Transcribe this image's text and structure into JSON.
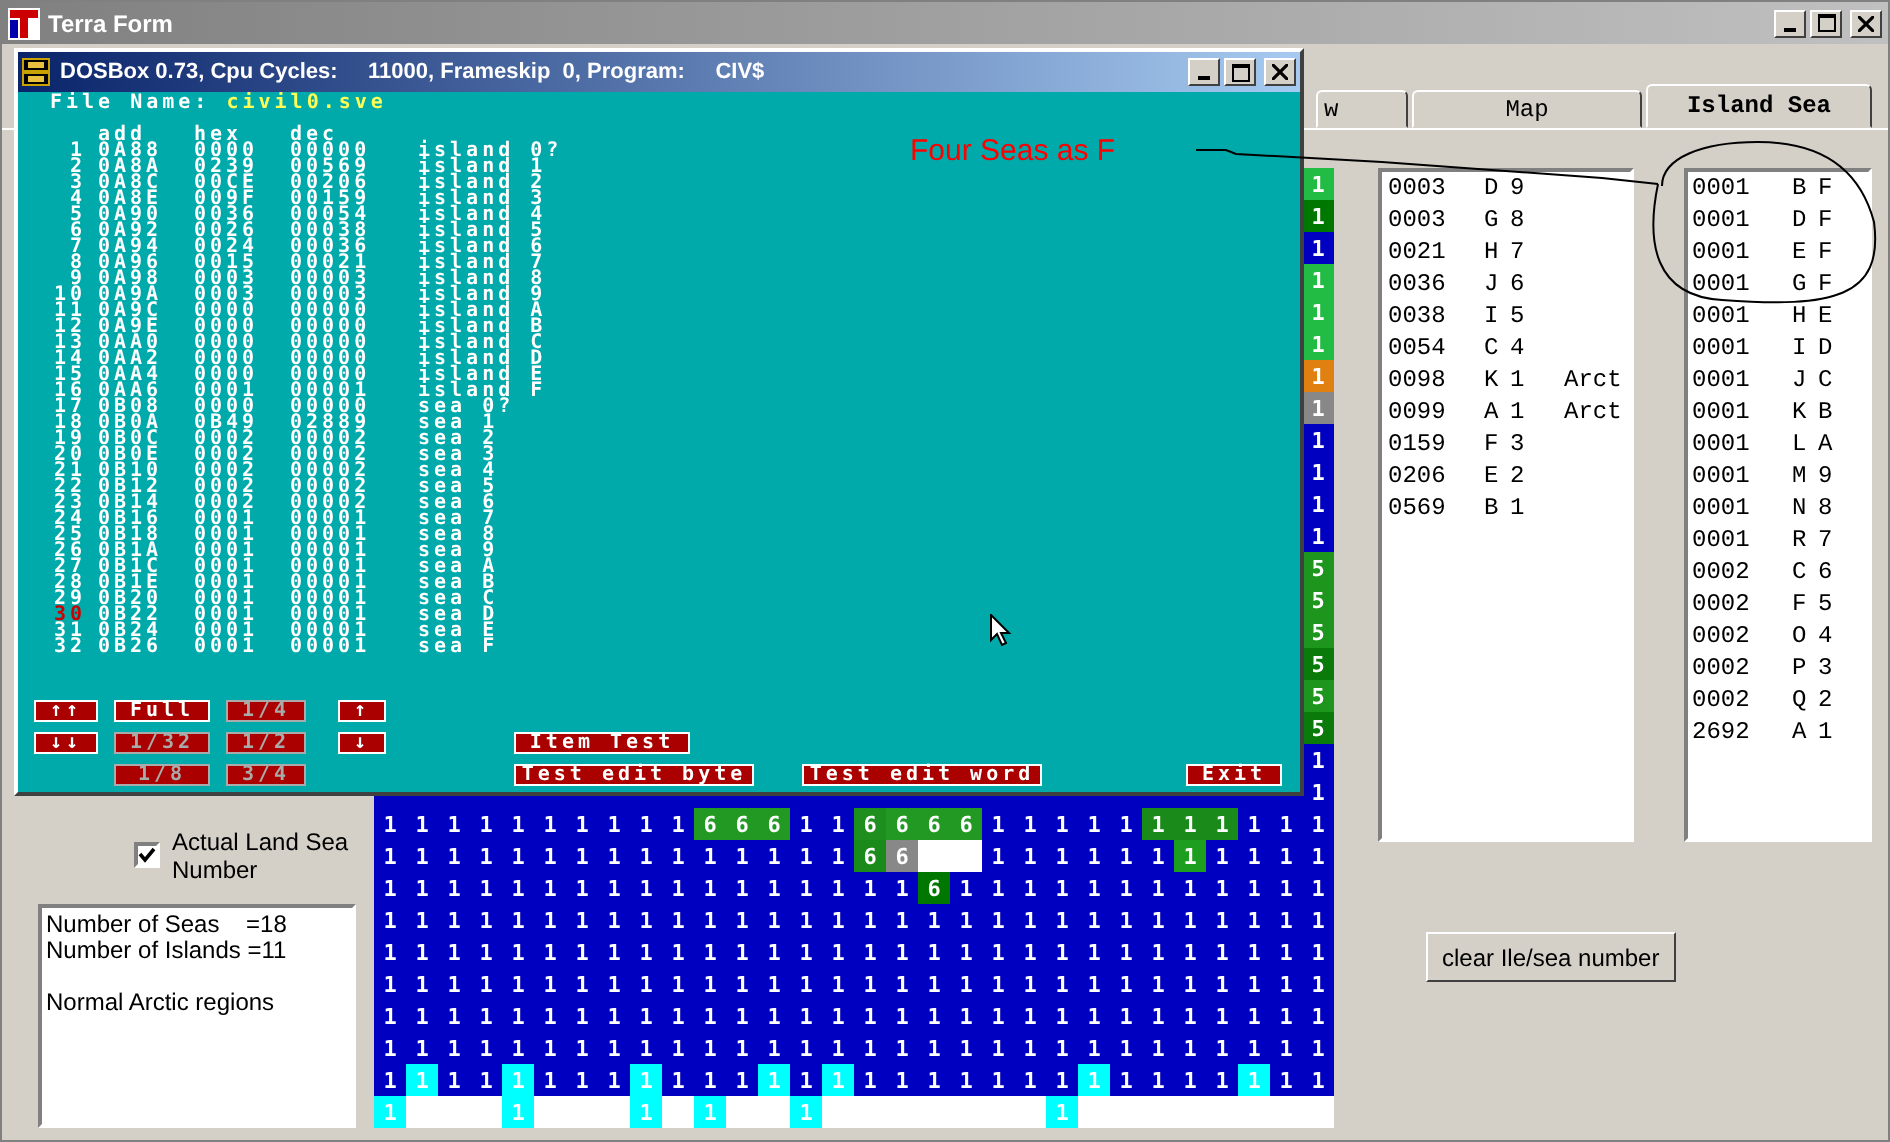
{
  "window": {
    "title": "Terra Form"
  },
  "tabs": [
    {
      "label": "w",
      "selected": false
    },
    {
      "label": "Map",
      "selected": false
    },
    {
      "label": "Island Sea",
      "selected": true
    }
  ],
  "left_panel": {
    "checkbox": {
      "label": "Actual Land Sea Number",
      "checked": true
    },
    "info_paragraphs": [
      [
        "Number of Seas    =18",
        "Number of Islands =11"
      ],
      [
        "Normal Arctic regions"
      ]
    ]
  },
  "map": {
    "edge_cells": [
      {
        "value": "1",
        "color": "#22bb44"
      },
      {
        "value": "1",
        "color": "#007700"
      },
      {
        "value": "1",
        "color": "#0000c0"
      },
      {
        "value": "1",
        "color": "#22bb44"
      },
      {
        "value": "1",
        "color": "#22bb44"
      },
      {
        "value": "1",
        "color": "#22bb44"
      },
      {
        "value": "1",
        "color": "#e08010"
      },
      {
        "value": "1",
        "color": "#888888"
      },
      {
        "value": "1",
        "color": "#0000c0"
      },
      {
        "value": "1",
        "color": "#0000c0"
      },
      {
        "value": "1",
        "color": "#0000c0"
      },
      {
        "value": "1",
        "color": "#0000c0"
      },
      {
        "value": "5",
        "color": "#1e961e"
      },
      {
        "value": "5",
        "color": "#1e961e"
      },
      {
        "value": "5",
        "color": "#1e961e"
      },
      {
        "value": "5",
        "color": "#0a7a0a"
      },
      {
        "value": "5",
        "color": "#1e961e"
      },
      {
        "value": "5",
        "color": "#0a7a0a"
      },
      {
        "value": "1",
        "color": "#0000c0"
      },
      {
        "value": "1",
        "color": "#0000c0"
      }
    ],
    "rows": [
      {
        "cells": [
          {
            "value": "1",
            "color": "#0000c0"
          },
          {
            "value": "1",
            "color": "#0000c0"
          },
          {
            "value": "1",
            "color": "#0000c0"
          },
          {
            "value": "1",
            "color": "#0000c0"
          },
          {
            "value": "1",
            "color": "#0000c0"
          },
          {
            "value": "1",
            "color": "#0000c0"
          },
          {
            "value": "1",
            "color": "#0000c0"
          },
          {
            "value": "1",
            "color": "#0000c0"
          },
          {
            "value": "1",
            "color": "#0000c0"
          },
          {
            "value": "1",
            "color": "#0000c0"
          },
          {
            "value": "6",
            "color": "#229922"
          },
          {
            "value": "6",
            "color": "#229922"
          },
          {
            "value": "6",
            "color": "#229922"
          },
          {
            "value": "1",
            "color": "#0000c0"
          },
          {
            "value": "1",
            "color": "#0000c0"
          },
          {
            "value": "6",
            "color": "#1e8e1e"
          },
          {
            "value": "6",
            "color": "#229922"
          },
          {
            "value": "6",
            "color": "#229922"
          },
          {
            "value": "6",
            "color": "#229922"
          },
          {
            "value": "1",
            "color": "#0000c0"
          },
          {
            "value": "1",
            "color": "#0000c0"
          },
          {
            "value": "1",
            "color": "#0000c0"
          },
          {
            "value": "1",
            "color": "#0000c0"
          },
          {
            "value": "1",
            "color": "#0000c0"
          },
          {
            "value": "1",
            "color": "#1a8a1a"
          },
          {
            "value": "1",
            "color": "#1a8a1a"
          },
          {
            "value": "1",
            "color": "#1a8a1a"
          },
          {
            "value": "1",
            "color": "#0000c0"
          },
          {
            "value": "1",
            "color": "#0000c0"
          },
          {
            "value": "1",
            "color": "#0000c0"
          }
        ]
      },
      {
        "cells": [
          {
            "value": "1",
            "color": "#0000c0"
          },
          {
            "value": "1",
            "color": "#0000c0"
          },
          {
            "value": "1",
            "color": "#0000c0"
          },
          {
            "value": "1",
            "color": "#0000c0"
          },
          {
            "value": "1",
            "color": "#0000c0"
          },
          {
            "value": "1",
            "color": "#0000c0"
          },
          {
            "value": "1",
            "color": "#0000c0"
          },
          {
            "value": "1",
            "color": "#0000c0"
          },
          {
            "value": "1",
            "color": "#0000c0"
          },
          {
            "value": "1",
            "color": "#0000c0"
          },
          {
            "value": "1",
            "color": "#0000c0"
          },
          {
            "value": "1",
            "color": "#0000c0"
          },
          {
            "value": "1",
            "color": "#0000c0"
          },
          {
            "value": "1",
            "color": "#0000c0"
          },
          {
            "value": "1",
            "color": "#0000c0"
          },
          {
            "value": "6",
            "color": "#1a8a1a"
          },
          {
            "value": "6",
            "color": "#888888"
          },
          {
            "color": "#ffffff"
          },
          {
            "color": "#ffffff"
          },
          {
            "value": "1",
            "color": "#0000c0"
          },
          {
            "value": "1",
            "color": "#0000c0"
          },
          {
            "value": "1",
            "color": "#0000c0"
          },
          {
            "value": "1",
            "color": "#0000c0"
          },
          {
            "value": "1",
            "color": "#0000c0"
          },
          {
            "value": "1",
            "color": "#0000c0"
          },
          {
            "value": "1",
            "color": "#1e9e1e"
          },
          {
            "value": "1",
            "color": "#0000c0"
          },
          {
            "value": "1",
            "color": "#0000c0"
          },
          {
            "value": "1",
            "color": "#0000c0"
          },
          {
            "value": "1",
            "color": "#0000c0"
          }
        ]
      },
      {
        "cells": [
          {
            "value": "1",
            "color": "#0000c0"
          },
          {
            "value": "1",
            "color": "#0000c0"
          },
          {
            "value": "1",
            "color": "#0000c0"
          },
          {
            "value": "1",
            "color": "#0000c0"
          },
          {
            "value": "1",
            "color": "#0000c0"
          },
          {
            "value": "1",
            "color": "#0000c0"
          },
          {
            "value": "1",
            "color": "#0000c0"
          },
          {
            "value": "1",
            "color": "#0000c0"
          },
          {
            "value": "1",
            "color": "#0000c0"
          },
          {
            "value": "1",
            "color": "#0000c0"
          },
          {
            "value": "1",
            "color": "#0000c0"
          },
          {
            "value": "1",
            "color": "#0000c0"
          },
          {
            "value": "1",
            "color": "#0000c0"
          },
          {
            "value": "1",
            "color": "#0000c0"
          },
          {
            "value": "1",
            "color": "#0000c0"
          },
          {
            "value": "1",
            "color": "#0000c0"
          },
          {
            "value": "1",
            "color": "#0000c0"
          },
          {
            "value": "6",
            "color": "#007700"
          },
          {
            "value": "1",
            "color": "#0000c0"
          },
          {
            "value": "1",
            "color": "#0000c0"
          },
          {
            "value": "1",
            "color": "#0000c0"
          },
          {
            "value": "1",
            "color": "#0000c0"
          },
          {
            "value": "1",
            "color": "#0000c0"
          },
          {
            "value": "1",
            "color": "#0000c0"
          },
          {
            "value": "1",
            "color": "#0000c0"
          },
          {
            "value": "1",
            "color": "#0000c0"
          },
          {
            "value": "1",
            "color": "#0000c0"
          },
          {
            "value": "1",
            "color": "#0000c0"
          },
          {
            "value": "1",
            "color": "#0000c0"
          },
          {
            "value": "1",
            "color": "#0000c0"
          }
        ]
      },
      {
        "cells": [
          {
            "value": "1",
            "color": "#0000c0"
          },
          {
            "value": "1",
            "color": "#0000c0"
          },
          {
            "value": "1",
            "color": "#0000c0"
          },
          {
            "value": "1",
            "color": "#0000c0"
          },
          {
            "value": "1",
            "color": "#0000c0"
          },
          {
            "value": "1",
            "color": "#0000c0"
          },
          {
            "value": "1",
            "color": "#0000c0"
          },
          {
            "value": "1",
            "color": "#0000c0"
          },
          {
            "value": "1",
            "color": "#0000c0"
          },
          {
            "value": "1",
            "color": "#0000c0"
          },
          {
            "value": "1",
            "color": "#0000c0"
          },
          {
            "value": "1",
            "color": "#0000c0"
          },
          {
            "value": "1",
            "color": "#0000c0"
          },
          {
            "value": "1",
            "color": "#0000c0"
          },
          {
            "value": "1",
            "color": "#0000c0"
          },
          {
            "value": "1",
            "color": "#0000c0"
          },
          {
            "value": "1",
            "color": "#0000c0"
          },
          {
            "value": "1",
            "color": "#0000c0"
          },
          {
            "value": "1",
            "color": "#0000c0"
          },
          {
            "value": "1",
            "color": "#0000c0"
          },
          {
            "value": "1",
            "color": "#0000c0"
          },
          {
            "value": "1",
            "color": "#0000c0"
          },
          {
            "value": "1",
            "color": "#0000c0"
          },
          {
            "value": "1",
            "color": "#0000c0"
          },
          {
            "value": "1",
            "color": "#0000c0"
          },
          {
            "value": "1",
            "color": "#0000c0"
          },
          {
            "value": "1",
            "color": "#0000c0"
          },
          {
            "value": "1",
            "color": "#0000c0"
          },
          {
            "value": "1",
            "color": "#0000c0"
          },
          {
            "value": "1",
            "color": "#0000c0"
          }
        ]
      },
      {
        "cells": [
          {
            "value": "1",
            "color": "#0000c0"
          },
          {
            "value": "1",
            "color": "#0000c0"
          },
          {
            "value": "1",
            "color": "#0000c0"
          },
          {
            "value": "1",
            "color": "#0000c0"
          },
          {
            "value": "1",
            "color": "#0000c0"
          },
          {
            "value": "1",
            "color": "#0000c0"
          },
          {
            "value": "1",
            "color": "#0000c0"
          },
          {
            "value": "1",
            "color": "#0000c0"
          },
          {
            "value": "1",
            "color": "#0000c0"
          },
          {
            "value": "1",
            "color": "#0000c0"
          },
          {
            "value": "1",
            "color": "#0000c0"
          },
          {
            "value": "1",
            "color": "#0000c0"
          },
          {
            "value": "1",
            "color": "#0000c0"
          },
          {
            "value": "1",
            "color": "#0000c0"
          },
          {
            "value": "1",
            "color": "#0000c0"
          },
          {
            "value": "1",
            "color": "#0000c0"
          },
          {
            "value": "1",
            "color": "#0000c0"
          },
          {
            "value": "1",
            "color": "#0000c0"
          },
          {
            "value": "1",
            "color": "#0000c0"
          },
          {
            "value": "1",
            "color": "#0000c0"
          },
          {
            "value": "1",
            "color": "#0000c0"
          },
          {
            "value": "1",
            "color": "#0000c0"
          },
          {
            "value": "1",
            "color": "#0000c0"
          },
          {
            "value": "1",
            "color": "#0000c0"
          },
          {
            "value": "1",
            "color": "#0000c0"
          },
          {
            "value": "1",
            "color": "#0000c0"
          },
          {
            "value": "1",
            "color": "#0000c0"
          },
          {
            "value": "1",
            "color": "#0000c0"
          },
          {
            "value": "1",
            "color": "#0000c0"
          },
          {
            "value": "1",
            "color": "#0000c0"
          }
        ]
      },
      {
        "cells": [
          {
            "value": "1",
            "color": "#0000c0"
          },
          {
            "value": "1",
            "color": "#0000c0"
          },
          {
            "value": "1",
            "color": "#0000c0"
          },
          {
            "value": "1",
            "color": "#0000c0"
          },
          {
            "value": "1",
            "color": "#0000c0"
          },
          {
            "value": "1",
            "color": "#0000c0"
          },
          {
            "value": "1",
            "color": "#0000c0"
          },
          {
            "value": "1",
            "color": "#0000c0"
          },
          {
            "value": "1",
            "color": "#0000c0"
          },
          {
            "value": "1",
            "color": "#0000c0"
          },
          {
            "value": "1",
            "color": "#0000c0"
          },
          {
            "value": "1",
            "color": "#0000c0"
          },
          {
            "value": "1",
            "color": "#0000c0"
          },
          {
            "value": "1",
            "color": "#0000c0"
          },
          {
            "value": "1",
            "color": "#0000c0"
          },
          {
            "value": "1",
            "color": "#0000c0"
          },
          {
            "value": "1",
            "color": "#0000c0"
          },
          {
            "value": "1",
            "color": "#0000c0"
          },
          {
            "value": "1",
            "color": "#0000c0"
          },
          {
            "value": "1",
            "color": "#0000c0"
          },
          {
            "value": "1",
            "color": "#0000c0"
          },
          {
            "value": "1",
            "color": "#0000c0"
          },
          {
            "value": "1",
            "color": "#0000c0"
          },
          {
            "value": "1",
            "color": "#0000c0"
          },
          {
            "value": "1",
            "color": "#0000c0"
          },
          {
            "value": "1",
            "color": "#0000c0"
          },
          {
            "value": "1",
            "color": "#0000c0"
          },
          {
            "value": "1",
            "color": "#0000c0"
          },
          {
            "value": "1",
            "color": "#0000c0"
          },
          {
            "value": "1",
            "color": "#0000c0"
          }
        ]
      },
      {
        "cells": [
          {
            "value": "1",
            "color": "#0000c0"
          },
          {
            "value": "1",
            "color": "#0000c0"
          },
          {
            "value": "1",
            "color": "#0000c0"
          },
          {
            "value": "1",
            "color": "#0000c0"
          },
          {
            "value": "1",
            "color": "#0000c0"
          },
          {
            "value": "1",
            "color": "#0000c0"
          },
          {
            "value": "1",
            "color": "#0000c0"
          },
          {
            "value": "1",
            "color": "#0000c0"
          },
          {
            "value": "1",
            "color": "#0000c0"
          },
          {
            "value": "1",
            "color": "#0000c0"
          },
          {
            "value": "1",
            "color": "#0000c0"
          },
          {
            "value": "1",
            "color": "#0000c0"
          },
          {
            "value": "1",
            "color": "#0000c0"
          },
          {
            "value": "1",
            "color": "#0000c0"
          },
          {
            "value": "1",
            "color": "#0000c0"
          },
          {
            "value": "1",
            "color": "#0000c0"
          },
          {
            "value": "1",
            "color": "#0000c0"
          },
          {
            "value": "1",
            "color": "#0000c0"
          },
          {
            "value": "1",
            "color": "#0000c0"
          },
          {
            "value": "1",
            "color": "#0000c0"
          },
          {
            "value": "1",
            "color": "#0000c0"
          },
          {
            "value": "1",
            "color": "#0000c0"
          },
          {
            "value": "1",
            "color": "#0000c0"
          },
          {
            "value": "1",
            "color": "#0000c0"
          },
          {
            "value": "1",
            "color": "#0000c0"
          },
          {
            "value": "1",
            "color": "#0000c0"
          },
          {
            "value": "1",
            "color": "#0000c0"
          },
          {
            "value": "1",
            "color": "#0000c0"
          },
          {
            "value": "1",
            "color": "#0000c0"
          },
          {
            "value": "1",
            "color": "#0000c0"
          }
        ]
      },
      {
        "cells": [
          {
            "value": "1",
            "color": "#0000c0"
          },
          {
            "value": "1",
            "color": "#0000c0"
          },
          {
            "value": "1",
            "color": "#0000c0"
          },
          {
            "value": "1",
            "color": "#0000c0"
          },
          {
            "value": "1",
            "color": "#0000c0"
          },
          {
            "value": "1",
            "color": "#0000c0"
          },
          {
            "value": "1",
            "color": "#0000c0"
          },
          {
            "value": "1",
            "color": "#0000c0"
          },
          {
            "value": "1",
            "color": "#0000c0"
          },
          {
            "value": "1",
            "color": "#0000c0"
          },
          {
            "value": "1",
            "color": "#0000c0"
          },
          {
            "value": "1",
            "color": "#0000c0"
          },
          {
            "value": "1",
            "color": "#0000c0"
          },
          {
            "value": "1",
            "color": "#0000c0"
          },
          {
            "value": "1",
            "color": "#0000c0"
          },
          {
            "value": "1",
            "color": "#0000c0"
          },
          {
            "value": "1",
            "color": "#0000c0"
          },
          {
            "value": "1",
            "color": "#0000c0"
          },
          {
            "value": "1",
            "color": "#0000c0"
          },
          {
            "value": "1",
            "color": "#0000c0"
          },
          {
            "value": "1",
            "color": "#0000c0"
          },
          {
            "value": "1",
            "color": "#0000c0"
          },
          {
            "value": "1",
            "color": "#0000c0"
          },
          {
            "value": "1",
            "color": "#0000c0"
          },
          {
            "value": "1",
            "color": "#0000c0"
          },
          {
            "value": "1",
            "color": "#0000c0"
          },
          {
            "value": "1",
            "color": "#0000c0"
          },
          {
            "value": "1",
            "color": "#0000c0"
          },
          {
            "value": "1",
            "color": "#0000c0"
          },
          {
            "value": "1",
            "color": "#0000c0"
          }
        ]
      },
      {
        "cells": [
          {
            "value": "1",
            "color": "#0000c0"
          },
          {
            "value": "1",
            "color": "#00ffff"
          },
          {
            "value": "1",
            "color": "#0000c0"
          },
          {
            "value": "1",
            "color": "#0000c0"
          },
          {
            "value": "1",
            "color": "#00ffff"
          },
          {
            "value": "1",
            "color": "#0000c0"
          },
          {
            "value": "1",
            "color": "#0000c0"
          },
          {
            "value": "1",
            "color": "#0000c0"
          },
          {
            "value": "1",
            "color": "#00ffff"
          },
          {
            "value": "1",
            "color": "#0000c0"
          },
          {
            "value": "1",
            "color": "#0000c0"
          },
          {
            "value": "1",
            "color": "#0000c0"
          },
          {
            "value": "1",
            "color": "#00ffff"
          },
          {
            "value": "1",
            "color": "#0000c0"
          },
          {
            "value": "1",
            "color": "#00ffff"
          },
          {
            "value": "1",
            "color": "#0000c0"
          },
          {
            "value": "1",
            "color": "#0000c0"
          },
          {
            "value": "1",
            "color": "#0000c0"
          },
          {
            "value": "1",
            "color": "#0000c0"
          },
          {
            "value": "1",
            "color": "#0000c0"
          },
          {
            "value": "1",
            "color": "#0000c0"
          },
          {
            "value": "1",
            "color": "#0000c0"
          },
          {
            "value": "1",
            "color": "#00ffff"
          },
          {
            "value": "1",
            "color": "#0000c0"
          },
          {
            "value": "1",
            "color": "#0000c0"
          },
          {
            "value": "1",
            "color": "#0000c0"
          },
          {
            "value": "1",
            "color": "#0000c0"
          },
          {
            "value": "1",
            "color": "#00ffff"
          },
          {
            "value": "1",
            "color": "#0000c0"
          },
          {
            "value": "1",
            "color": "#0000c0"
          }
        ]
      },
      {
        "cells": [
          {
            "value": "1",
            "color": "#00ffff"
          },
          {
            "color": "#ffffff"
          },
          {
            "color": "#ffffff"
          },
          {
            "color": "#ffffff"
          },
          {
            "value": "1",
            "color": "#00ffff"
          },
          {
            "color": "#ffffff"
          },
          {
            "color": "#ffffff"
          },
          {
            "color": "#ffffff"
          },
          {
            "value": "1",
            "color": "#00ffff"
          },
          {
            "color": "#ffffff"
          },
          {
            "value": "1",
            "color": "#00ffff"
          },
          {
            "color": "#ffffff"
          },
          {
            "color": "#ffffff"
          },
          {
            "value": "1",
            "color": "#00ffff"
          },
          {
            "color": "#ffffff"
          },
          {
            "color": "#ffffff"
          },
          {
            "color": "#ffffff"
          },
          {
            "color": "#ffffff"
          },
          {
            "color": "#ffffff"
          },
          {
            "color": "#ffffff"
          },
          {
            "color": "#ffffff"
          },
          {
            "value": "1",
            "color": "#00ffff"
          },
          {
            "color": "#ffffff"
          },
          {
            "color": "#ffffff"
          },
          {
            "color": "#ffffff"
          },
          {
            "color": "#ffffff"
          },
          {
            "color": "#ffffff"
          },
          {
            "color": "#ffffff"
          },
          {
            "color": "#ffffff"
          },
          {
            "color": "#ffffff"
          }
        ]
      }
    ]
  },
  "island_list": {
    "rows": [
      {
        "column_1": "0003",
        "column_2": "D",
        "column_3": "9"
      },
      {
        "column_1": "0003",
        "column_2": "G",
        "column_3": "8"
      },
      {
        "column_1": "0021",
        "column_2": "H",
        "column_3": "7"
      },
      {
        "column_1": "0036",
        "column_2": "J",
        "column_3": "6"
      },
      {
        "column_1": "0038",
        "column_2": "I",
        "column_3": "5"
      },
      {
        "column_1": "0054",
        "column_2": "C",
        "column_3": "4"
      },
      {
        "column_1": "0098",
        "column_2": "K",
        "column_3": "1",
        "column_4": "Arct"
      },
      {
        "column_1": "0099",
        "column_2": "A",
        "column_3": "1",
        "column_4": "Arct"
      },
      {
        "column_1": "0159",
        "column_2": "F",
        "column_3": "3"
      },
      {
        "column_1": "0206",
        "column_2": "E",
        "column_3": "2"
      },
      {
        "column_1": "0569",
        "column_2": "B",
        "column_3": "1"
      }
    ]
  },
  "sea_list": {
    "rows": [
      {
        "column_1": "0001",
        "column_2": "B",
        "column_3": "F"
      },
      {
        "column_1": "0001",
        "column_2": "D",
        "column_3": "F"
      },
      {
        "column_1": "0001",
        "column_2": "E",
        "column_3": "F"
      },
      {
        "column_1": "0001",
        "column_2": "G",
        "column_3": "F"
      },
      {
        "column_1": "0001",
        "column_2": "H",
        "column_3": "E"
      },
      {
        "column_1": "0001",
        "column_2": "I",
        "column_3": "D"
      },
      {
        "column_1": "0001",
        "column_2": "J",
        "column_3": "C"
      },
      {
        "column_1": "0001",
        "column_2": "K",
        "column_3": "B"
      },
      {
        "column_1": "0001",
        "column_2": "L",
        "column_3": "A"
      },
      {
        "column_1": "0001",
        "column_2": "M",
        "column_3": "9"
      },
      {
        "column_1": "0001",
        "column_2": "N",
        "column_3": "8"
      },
      {
        "column_1": "0001",
        "column_2": "R",
        "column_3": "7"
      },
      {
        "column_1": "0002",
        "column_2": "C",
        "column_3": "6"
      },
      {
        "column_1": "0002",
        "column_2": "F",
        "column_3": "5"
      },
      {
        "column_1": "0002",
        "column_2": "O",
        "column_3": "4"
      },
      {
        "column_1": "0002",
        "column_2": "P",
        "column_3": "3"
      },
      {
        "column_1": "0002",
        "column_2": "Q",
        "column_3": "2"
      },
      {
        "column_1": "2692",
        "column_2": "A",
        "column_3": "1"
      }
    ]
  },
  "clear_button": {
    "label": "clear Ile/sea number"
  },
  "dosbox": {
    "title": "DOSBox 0.73, Cpu Cycles:     11000, Frameskip  0, Program:     CIV$",
    "file_name_label": "File Name:",
    "file_name": "civil0.sve",
    "columns": [
      "add",
      "hex",
      "dec"
    ],
    "rows": [
      {
        "number": "1",
        "add": "0A88",
        "hex": "0000",
        "dec": "00000",
        "name": "island 0?",
        "highlighted": false
      },
      {
        "number": "2",
        "add": "0A8A",
        "hex": "0239",
        "dec": "00569",
        "name": "island 1",
        "highlighted": false
      },
      {
        "number": "3",
        "add": "0A8C",
        "hex": "00CE",
        "dec": "00206",
        "name": "island 2",
        "highlighted": false
      },
      {
        "number": "4",
        "add": "0A8E",
        "hex": "009F",
        "dec": "00159",
        "name": "island 3",
        "highlighted": false
      },
      {
        "number": "5",
        "add": "0A90",
        "hex": "0036",
        "dec": "00054",
        "name": "island 4",
        "highlighted": false
      },
      {
        "number": "6",
        "add": "0A92",
        "hex": "0026",
        "dec": "00038",
        "name": "island 5",
        "highlighted": false
      },
      {
        "number": "7",
        "add": "0A94",
        "hex": "0024",
        "dec": "00036",
        "name": "island 6",
        "highlighted": false
      },
      {
        "number": "8",
        "add": "0A96",
        "hex": "0015",
        "dec": "00021",
        "name": "island 7",
        "highlighted": false
      },
      {
        "number": "9",
        "add": "0A98",
        "hex": "0003",
        "dec": "00003",
        "name": "island 8",
        "highlighted": false
      },
      {
        "number": "10",
        "add": "0A9A",
        "hex": "0003",
        "dec": "00003",
        "name": "island 9",
        "highlighted": false
      },
      {
        "number": "11",
        "add": "0A9C",
        "hex": "0000",
        "dec": "00000",
        "name": "island A",
        "highlighted": false
      },
      {
        "number": "12",
        "add": "0A9E",
        "hex": "0000",
        "dec": "00000",
        "name": "island B",
        "highlighted": false
      },
      {
        "number": "13",
        "add": "0AA0",
        "hex": "0000",
        "dec": "00000",
        "name": "island C",
        "highlighted": false
      },
      {
        "number": "14",
        "add": "0AA2",
        "hex": "0000",
        "dec": "00000",
        "name": "island D",
        "highlighted": false
      },
      {
        "number": "15",
        "add": "0AA4",
        "hex": "0000",
        "dec": "00000",
        "name": "island E",
        "highlighted": false
      },
      {
        "number": "16",
        "add": "0AA6",
        "hex": "0001",
        "dec": "00001",
        "name": "island F",
        "highlighted": false
      },
      {
        "number": "17",
        "add": "0B08",
        "hex": "0000",
        "dec": "00000",
        "name": "sea 0?",
        "highlighted": false
      },
      {
        "number": "18",
        "add": "0B0A",
        "hex": "0B49",
        "dec": "02889",
        "name": "sea 1",
        "highlighted": false
      },
      {
        "number": "19",
        "add": "0B0C",
        "hex": "0002",
        "dec": "00002",
        "name": "sea 2",
        "highlighted": false
      },
      {
        "number": "20",
        "add": "0B0E",
        "hex": "0002",
        "dec": "00002",
        "name": "sea 3",
        "highlighted": false
      },
      {
        "number": "21",
        "add": "0B10",
        "hex": "0002",
        "dec": "00002",
        "name": "sea 4",
        "highlighted": false
      },
      {
        "number": "22",
        "add": "0B12",
        "hex": "0002",
        "dec": "00002",
        "name": "sea 5",
        "highlighted": false
      },
      {
        "number": "23",
        "add": "0B14",
        "hex": "0002",
        "dec": "00002",
        "name": "sea 6",
        "highlighted": false
      },
      {
        "number": "24",
        "add": "0B16",
        "hex": "0001",
        "dec": "00001",
        "name": "sea 7",
        "highlighted": false
      },
      {
        "number": "25",
        "add": "0B18",
        "hex": "0001",
        "dec": "00001",
        "name": "sea 8",
        "highlighted": false
      },
      {
        "number": "26",
        "add": "0B1A",
        "hex": "0001",
        "dec": "00001",
        "name": "sea 9",
        "highlighted": false
      },
      {
        "number": "27",
        "add": "0B1C",
        "hex": "0001",
        "dec": "00001",
        "name": "sea A",
        "highlighted": false
      },
      {
        "number": "28",
        "add": "0B1E",
        "hex": "0001",
        "dec": "00001",
        "name": "sea B",
        "highlighted": false
      },
      {
        "number": "29",
        "add": "0B20",
        "hex": "0001",
        "dec": "00001",
        "name": "sea C",
        "highlighted": false
      },
      {
        "number": "30",
        "add": "0B22",
        "hex": "0001",
        "dec": "00001",
        "name": "sea D",
        "highlighted": true
      },
      {
        "number": "31",
        "add": "0B24",
        "hex": "0001",
        "dec": "00001",
        "name": "sea E",
        "highlighted": false
      },
      {
        "number": "32",
        "add": "0B26",
        "hex": "0001",
        "dec": "00001",
        "name": "sea F",
        "highlighted": false
      }
    ],
    "note": "Four Seas as F",
    "buttons": [
      {
        "label": "↑↑",
        "disabled": false
      },
      {
        "label": "Full",
        "disabled": false
      },
      {
        "label": "1/4",
        "disabled": true
      },
      {
        "label": "↑",
        "disabled": false
      },
      {
        "label": "↓↓",
        "disabled": false
      },
      {
        "label": "1/32",
        "disabled": true
      },
      {
        "label": "1/2",
        "disabled": true
      },
      {
        "label": "↓",
        "disabled": false
      },
      {
        "label": "Item Test",
        "disabled": false
      },
      {
        "label": "1/8",
        "disabled": true
      },
      {
        "label": "3/4",
        "disabled": true
      },
      {
        "label": "Test edit byte",
        "disabled": false
      },
      {
        "label": "Test edit word",
        "disabled": false
      },
      {
        "label": "Exit",
        "disabled": false
      }
    ]
  }
}
